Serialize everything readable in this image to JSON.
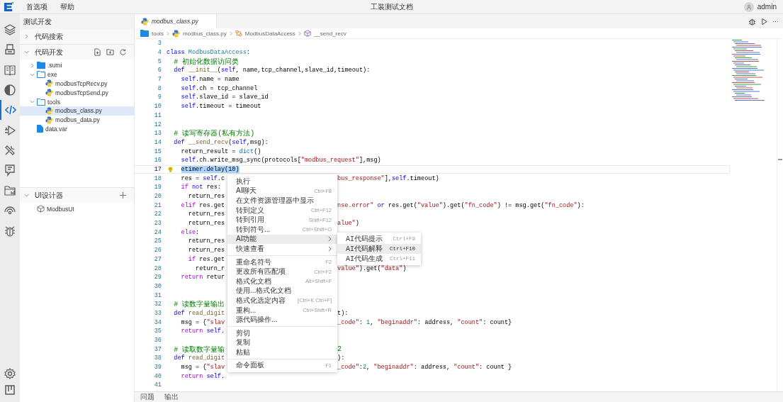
{
  "menu_bar": [
    "首选项",
    "帮助"
  ],
  "window": {
    "title": "工装测试文档"
  },
  "user": {
    "name": "admin"
  },
  "activity_bar": {
    "top": [
      {
        "kind": "layers",
        "selected": false
      },
      {
        "kind": "device",
        "selected": false
      },
      {
        "kind": "book",
        "selected": false
      },
      {
        "kind": "contrast",
        "selected": false
      },
      {
        "kind": "code",
        "selected": true
      },
      {
        "kind": "run",
        "selected": false
      },
      {
        "kind": "tools",
        "selected": false
      },
      {
        "kind": "board",
        "selected": false
      },
      {
        "kind": "folder-chart",
        "selected": false
      },
      {
        "kind": "signal",
        "selected": false
      },
      {
        "kind": "bug",
        "selected": false
      }
    ],
    "bottom": [
      {
        "kind": "settings",
        "selected": false
      },
      {
        "kind": "kanban",
        "selected": false
      }
    ]
  },
  "sidebar": {
    "title": "测试开发",
    "sections": [
      {
        "title": "代码搜索",
        "expanded": false
      },
      {
        "title": "代码开发",
        "expanded": true,
        "actions": [
          {
            "kind": "new-file"
          },
          {
            "kind": "new-folder"
          },
          {
            "kind": "refresh"
          }
        ],
        "tree": [
          {
            "label": ".sumi",
            "kind": "folder",
            "expanded": false,
            "selected": false
          },
          {
            "label": "exe",
            "kind": "folder",
            "expanded": true,
            "selected": false,
            "children": [
              {
                "label": "modbusTcpRecv.py",
                "kind": "python",
                "selected": false
              },
              {
                "label": "modbusTcpSend.py",
                "kind": "python",
                "selected": false
              }
            ]
          },
          {
            "label": "tools",
            "kind": "folder",
            "expanded": true,
            "selected": false,
            "children": [
              {
                "label": "modbus_class.py",
                "kind": "python",
                "selected": true
              },
              {
                "label": "modbus_data.py",
                "kind": "python",
                "selected": false
              }
            ]
          },
          {
            "label": "data.var",
            "kind": "file",
            "selected": false
          }
        ]
      },
      {
        "title": "UI设计器",
        "expanded": true,
        "actions": [
          {
            "kind": "add"
          }
        ],
        "tree": [
          {
            "label": "ModbusUI",
            "kind": "ui",
            "selected": false
          }
        ]
      }
    ]
  },
  "editor": {
    "tabs": [
      {
        "label": "modbus_class.py",
        "selected": true,
        "preview": true
      }
    ],
    "actions": [
      {
        "kind": "debug"
      },
      {
        "kind": "run"
      },
      {
        "kind": "more",
        "label": "···"
      }
    ],
    "breadcrumb": [
      {
        "label": "tools",
        "kind": "folder"
      },
      {
        "label": "modbus_class.py",
        "kind": "python"
      },
      {
        "label": "ModbusDataAccess",
        "kind": "class"
      },
      {
        "label": "__send_recv",
        "kind": "method"
      }
    ],
    "lines": [
      {
        "n": "3",
        "selected": false
      },
      {
        "n": "4",
        "selected": false,
        "tokens": [
          {
            "text": "class ",
            "kind": "kw"
          },
          {
            "text": "ModbusDataAccess",
            "kind": "cls"
          },
          {
            "text": ":",
            "kind": "plain"
          }
        ]
      },
      {
        "n": "5",
        "selected": false,
        "tokens": [
          {
            "text": "  # 初始化数据访问类",
            "kind": "comment"
          }
        ]
      },
      {
        "n": "6",
        "selected": false,
        "tokens": [
          {
            "text": "  def ",
            "kind": "kw"
          },
          {
            "text": "__init__",
            "kind": "fn"
          },
          {
            "text": "(",
            "kind": "plain"
          },
          {
            "text": "self",
            "kind": "self"
          },
          {
            "text": ", name,tcp_channel,slave_id,timeout):",
            "kind": "plain"
          }
        ]
      },
      {
        "n": "7",
        "selected": false,
        "tokens": [
          {
            "text": "    self",
            "kind": "self"
          },
          {
            "text": ".name = name",
            "kind": "plain"
          }
        ]
      },
      {
        "n": "8",
        "selected": false,
        "tokens": [
          {
            "text": "    self",
            "kind": "self"
          },
          {
            "text": ".ch = tcp_channel",
            "kind": "plain"
          }
        ]
      },
      {
        "n": "9",
        "selected": false,
        "tokens": [
          {
            "text": "    self",
            "kind": "self"
          },
          {
            "text": ".slave_id = slave_id",
            "kind": "plain"
          }
        ]
      },
      {
        "n": "10",
        "selected": false,
        "tokens": [
          {
            "text": "    self",
            "kind": "self"
          },
          {
            "text": ".timeout = timeout",
            "kind": "plain"
          }
        ]
      },
      {
        "n": "11",
        "selected": false
      },
      {
        "n": "12",
        "selected": false
      },
      {
        "n": "13",
        "selected": false,
        "tokens": [
          {
            "text": "  # 读写寄存器(私有方法)",
            "kind": "comment"
          }
        ]
      },
      {
        "n": "14",
        "selected": false,
        "tokens": [
          {
            "text": "  def ",
            "kind": "kw"
          },
          {
            "text": "__send_recv",
            "kind": "fn"
          },
          {
            "text": "(",
            "kind": "plain"
          },
          {
            "text": "self",
            "kind": "self"
          },
          {
            "text": ",msg):",
            "kind": "plain"
          }
        ]
      },
      {
        "n": "15",
        "selected": false,
        "tokens": [
          {
            "text": "    return_result = ",
            "kind": "plain"
          },
          {
            "text": "dict",
            "kind": "builtin"
          },
          {
            "text": "()",
            "kind": "plain"
          }
        ]
      },
      {
        "n": "16",
        "selected": false,
        "tokens": [
          {
            "text": "    self",
            "kind": "self"
          },
          {
            "text": ".ch.write_msg_sync(protocols[",
            "kind": "plain"
          },
          {
            "text": "\"modbus_request\"",
            "kind": "string"
          },
          {
            "text": "],msg)",
            "kind": "plain"
          }
        ]
      },
      {
        "n": "17",
        "selected": true,
        "tokens": [
          {
            "text": "    etimer.delay(10)",
            "kind": "plain"
          }
        ]
      },
      {
        "n": "18",
        "selected": false,
        "tokens": [
          {
            "text": "    res = ",
            "kind": "plain"
          },
          {
            "text": "self",
            "kind": "self"
          },
          {
            "text": ".c",
            "kind": "plain"
          }
        ],
        "tail": [
          {
            "text": "bus_response\"",
            "kind": "string"
          },
          {
            "text": "],",
            "kind": "plain"
          },
          {
            "text": "self",
            "kind": "self"
          },
          {
            "text": ".timeout)",
            "kind": "plain"
          }
        ]
      },
      {
        "n": "19",
        "selected": false,
        "tokens": [
          {
            "text": "    if ",
            "kind": "ctrl"
          },
          {
            "text": "not",
            "kind": "kw"
          },
          {
            "text": " res:",
            "kind": "plain"
          }
        ]
      },
      {
        "n": "20",
        "selected": false,
        "tokens": [
          {
            "text": "      return_res",
            "kind": "plain"
          }
        ]
      },
      {
        "n": "21",
        "selected": false,
        "tokens": [
          {
            "text": "    elif",
            "kind": "ctrl"
          },
          {
            "text": " res.get",
            "kind": "plain"
          }
        ],
        "tail": [
          {
            "text": "nse.error\"",
            "kind": "string"
          },
          {
            "text": " or",
            "kind": "kw"
          },
          {
            "text": " res.get(",
            "kind": "plain"
          },
          {
            "text": "\"value\"",
            "kind": "string"
          },
          {
            "text": ").get(",
            "kind": "plain"
          },
          {
            "text": "\"fn_code\"",
            "kind": "string"
          },
          {
            "text": ") != msg.get(",
            "kind": "plain"
          },
          {
            "text": "\"fn_code\"",
            "kind": "string"
          },
          {
            "text": "):",
            "kind": "plain"
          }
        ]
      },
      {
        "n": "22",
        "selected": false,
        "tokens": [
          {
            "text": "      return_res",
            "kind": "plain"
          }
        ]
      },
      {
        "n": "23",
        "selected": false,
        "tokens": [
          {
            "text": "      return_res",
            "kind": "plain"
          }
        ],
        "tail": [
          {
            "text": "alue\"",
            "kind": "string"
          },
          {
            "text": ")",
            "kind": "plain"
          }
        ]
      },
      {
        "n": "24",
        "selected": false,
        "tokens": [
          {
            "text": "    else",
            "kind": "ctrl"
          },
          {
            "text": ":",
            "kind": "plain"
          }
        ]
      },
      {
        "n": "25",
        "selected": false,
        "tokens": [
          {
            "text": "      return_res",
            "kind": "plain"
          }
        ]
      },
      {
        "n": "26",
        "selected": false,
        "tokens": [
          {
            "text": "      return_res",
            "kind": "plain"
          }
        ]
      },
      {
        "n": "27",
        "selected": false,
        "tokens": [
          {
            "text": "      if",
            "kind": "ctrl"
          },
          {
            "text": " res.get",
            "kind": "plain"
          }
        ]
      },
      {
        "n": "28",
        "selected": false,
        "tokens": [
          {
            "text": "        return_r",
            "kind": "plain"
          }
        ],
        "tail": [
          {
            "text": "value\"",
            "kind": "string"
          },
          {
            "text": ").get(",
            "kind": "plain"
          },
          {
            "text": "\"data\"",
            "kind": "string"
          },
          {
            "text": ")",
            "kind": "plain"
          }
        ]
      },
      {
        "n": "29",
        "selected": false,
        "tokens": [
          {
            "text": "    return",
            "kind": "ctrl"
          },
          {
            "text": " retur",
            "kind": "plain"
          }
        ]
      },
      {
        "n": "30",
        "selected": false
      },
      {
        "n": "31",
        "selected": false
      },
      {
        "n": "32",
        "selected": false,
        "tokens": [
          {
            "text": "  # 读数字量输出",
            "kind": "comment"
          }
        ]
      },
      {
        "n": "33",
        "selected": false,
        "tokens": [
          {
            "text": "  def",
            "kind": "kw"
          },
          {
            "text": " read_digit",
            "kind": "fn"
          }
        ],
        "tail": [
          {
            "text": "t):",
            "kind": "plain"
          }
        ]
      },
      {
        "n": "34",
        "selected": false,
        "tokens": [
          {
            "text": "    msg = {",
            "kind": "plain"
          },
          {
            "text": "\"slav",
            "kind": "string"
          }
        ],
        "tail": [
          {
            "text": "_code\"",
            "kind": "string"
          },
          {
            "text": ": ",
            "kind": "plain"
          },
          {
            "text": "1",
            "kind": "num"
          },
          {
            "text": ", ",
            "kind": "plain"
          },
          {
            "text": "\"beginaddr\"",
            "kind": "string"
          },
          {
            "text": ": address, ",
            "kind": "plain"
          },
          {
            "text": "\"count\"",
            "kind": "string"
          },
          {
            "text": ": count}",
            "kind": "plain"
          }
        ]
      },
      {
        "n": "35",
        "selected": false,
        "tokens": [
          {
            "text": "    return",
            "kind": "ctrl"
          },
          {
            "text": " self",
            "kind": "self"
          },
          {
            "text": ".",
            "kind": "plain"
          }
        ]
      },
      {
        "n": "36",
        "selected": false
      },
      {
        "n": "37",
        "selected": false,
        "tokens": [
          {
            "text": "  # 读取数字量输",
            "kind": "comment"
          }
        ],
        "tail": [
          {
            "text": "2",
            "kind": "comment"
          }
        ]
      },
      {
        "n": "38",
        "selected": false,
        "tokens": [
          {
            "text": "  def",
            "kind": "kw"
          },
          {
            "text": " read_digit",
            "kind": "fn"
          }
        ],
        "tail": [
          {
            "text": "):",
            "kind": "plain"
          }
        ]
      },
      {
        "n": "39",
        "selected": false,
        "tokens": [
          {
            "text": "    msg = {",
            "kind": "plain"
          },
          {
            "text": "\"slav",
            "kind": "string"
          }
        ],
        "tail": [
          {
            "text": "_code\"",
            "kind": "string"
          },
          {
            "text": ":",
            "kind": "plain"
          },
          {
            "text": "2",
            "kind": "num"
          },
          {
            "text": ", ",
            "kind": "plain"
          },
          {
            "text": "\"beginaddr\"",
            "kind": "string"
          },
          {
            "text": ": address, ",
            "kind": "plain"
          },
          {
            "text": "\"count\"",
            "kind": "string"
          },
          {
            "text": ": count }",
            "kind": "plain"
          }
        ]
      },
      {
        "n": "40",
        "selected": false,
        "tokens": [
          {
            "text": "    return",
            "kind": "ctrl"
          },
          {
            "text": " self",
            "kind": "self"
          },
          {
            "text": ".",
            "kind": "plain"
          }
        ]
      },
      {
        "n": "41",
        "selected": false
      }
    ],
    "context_menu": {
      "groups": [
        [
          {
            "label": "执行",
            "submenu": false,
            "selected": false
          },
          {
            "label": "AI聊天",
            "shortcut": "Ctrl+F8",
            "submenu": false,
            "selected": false
          },
          {
            "label": "在文件资源管理器中显示",
            "submenu": false,
            "selected": false
          },
          {
            "label": "转到定义",
            "shortcut": "Ctrl+F12",
            "submenu": false,
            "selected": false
          },
          {
            "label": "转到引用",
            "shortcut": "Shift+F12",
            "submenu": false,
            "selected": false
          },
          {
            "label": "转到符号...",
            "shortcut": "Ctrl+Shift+O",
            "submenu": false,
            "selected": false
          },
          {
            "label": "AI功能",
            "submenu": true,
            "selected": true
          },
          {
            "label": "快速查看",
            "submenu": true,
            "selected": false
          }
        ],
        [
          {
            "label": "重命名符号",
            "shortcut": "F2",
            "submenu": false,
            "selected": false
          },
          {
            "label": "更改所有匹配项",
            "shortcut": "Ctrl+F2",
            "submenu": false,
            "selected": false
          },
          {
            "label": "格式化文档",
            "shortcut": "Alt+Shift+F",
            "submenu": false,
            "selected": false
          },
          {
            "label": "使用...格式化文档",
            "submenu": false,
            "selected": false
          },
          {
            "label": "格式化选定内容",
            "shortcut": "[Ctrl+K Ctrl+F]",
            "submenu": false,
            "selected": false
          },
          {
            "label": "重构...",
            "shortcut": "Ctrl+Shift+R",
            "submenu": false,
            "selected": false
          },
          {
            "label": "源代码操作...",
            "submenu": false,
            "selected": false
          }
        ],
        [
          {
            "label": "剪切",
            "submenu": false,
            "selected": false
          },
          {
            "label": "复制",
            "submenu": false,
            "selected": false
          },
          {
            "label": "粘贴",
            "submenu": false,
            "selected": false
          }
        ],
        [
          {
            "label": "命令面板",
            "shortcut": "F1",
            "submenu": false,
            "selected": false
          }
        ]
      ],
      "submenu": [
        {
          "label": "AI代码提示",
          "shortcut": "Ctrl+F9",
          "selected": false
        },
        {
          "label": "AI代码解释",
          "shortcut": "Ctrl+F10",
          "selected": true
        },
        {
          "label": "AI代码生成",
          "shortcut": "Ctrl+F11",
          "selected": false
        }
      ]
    }
  },
  "panel_tabs": [
    "问题",
    "输出"
  ]
}
